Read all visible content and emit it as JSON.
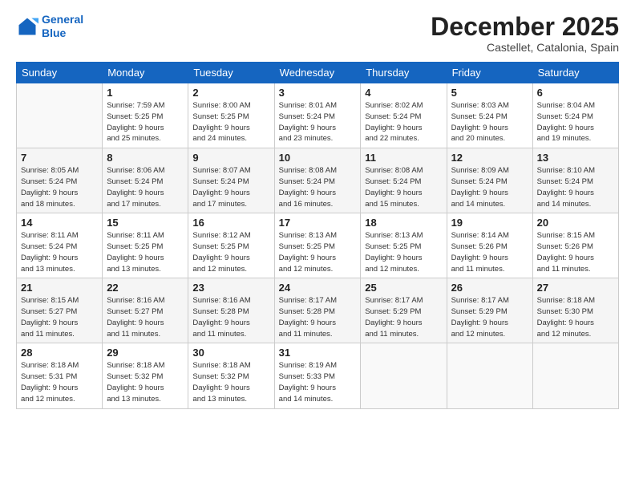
{
  "header": {
    "logo_line1": "General",
    "logo_line2": "Blue",
    "month_year": "December 2025",
    "location": "Castellet, Catalonia, Spain"
  },
  "weekdays": [
    "Sunday",
    "Monday",
    "Tuesday",
    "Wednesday",
    "Thursday",
    "Friday",
    "Saturday"
  ],
  "weeks": [
    [
      {
        "day": "",
        "info": ""
      },
      {
        "day": "1",
        "info": "Sunrise: 7:59 AM\nSunset: 5:25 PM\nDaylight: 9 hours\nand 25 minutes."
      },
      {
        "day": "2",
        "info": "Sunrise: 8:00 AM\nSunset: 5:25 PM\nDaylight: 9 hours\nand 24 minutes."
      },
      {
        "day": "3",
        "info": "Sunrise: 8:01 AM\nSunset: 5:24 PM\nDaylight: 9 hours\nand 23 minutes."
      },
      {
        "day": "4",
        "info": "Sunrise: 8:02 AM\nSunset: 5:24 PM\nDaylight: 9 hours\nand 22 minutes."
      },
      {
        "day": "5",
        "info": "Sunrise: 8:03 AM\nSunset: 5:24 PM\nDaylight: 9 hours\nand 20 minutes."
      },
      {
        "day": "6",
        "info": "Sunrise: 8:04 AM\nSunset: 5:24 PM\nDaylight: 9 hours\nand 19 minutes."
      }
    ],
    [
      {
        "day": "7",
        "info": "Sunrise: 8:05 AM\nSunset: 5:24 PM\nDaylight: 9 hours\nand 18 minutes."
      },
      {
        "day": "8",
        "info": "Sunrise: 8:06 AM\nSunset: 5:24 PM\nDaylight: 9 hours\nand 17 minutes."
      },
      {
        "day": "9",
        "info": "Sunrise: 8:07 AM\nSunset: 5:24 PM\nDaylight: 9 hours\nand 17 minutes."
      },
      {
        "day": "10",
        "info": "Sunrise: 8:08 AM\nSunset: 5:24 PM\nDaylight: 9 hours\nand 16 minutes."
      },
      {
        "day": "11",
        "info": "Sunrise: 8:08 AM\nSunset: 5:24 PM\nDaylight: 9 hours\nand 15 minutes."
      },
      {
        "day": "12",
        "info": "Sunrise: 8:09 AM\nSunset: 5:24 PM\nDaylight: 9 hours\nand 14 minutes."
      },
      {
        "day": "13",
        "info": "Sunrise: 8:10 AM\nSunset: 5:24 PM\nDaylight: 9 hours\nand 14 minutes."
      }
    ],
    [
      {
        "day": "14",
        "info": "Sunrise: 8:11 AM\nSunset: 5:24 PM\nDaylight: 9 hours\nand 13 minutes."
      },
      {
        "day": "15",
        "info": "Sunrise: 8:11 AM\nSunset: 5:25 PM\nDaylight: 9 hours\nand 13 minutes."
      },
      {
        "day": "16",
        "info": "Sunrise: 8:12 AM\nSunset: 5:25 PM\nDaylight: 9 hours\nand 12 minutes."
      },
      {
        "day": "17",
        "info": "Sunrise: 8:13 AM\nSunset: 5:25 PM\nDaylight: 9 hours\nand 12 minutes."
      },
      {
        "day": "18",
        "info": "Sunrise: 8:13 AM\nSunset: 5:25 PM\nDaylight: 9 hours\nand 12 minutes."
      },
      {
        "day": "19",
        "info": "Sunrise: 8:14 AM\nSunset: 5:26 PM\nDaylight: 9 hours\nand 11 minutes."
      },
      {
        "day": "20",
        "info": "Sunrise: 8:15 AM\nSunset: 5:26 PM\nDaylight: 9 hours\nand 11 minutes."
      }
    ],
    [
      {
        "day": "21",
        "info": "Sunrise: 8:15 AM\nSunset: 5:27 PM\nDaylight: 9 hours\nand 11 minutes."
      },
      {
        "day": "22",
        "info": "Sunrise: 8:16 AM\nSunset: 5:27 PM\nDaylight: 9 hours\nand 11 minutes."
      },
      {
        "day": "23",
        "info": "Sunrise: 8:16 AM\nSunset: 5:28 PM\nDaylight: 9 hours\nand 11 minutes."
      },
      {
        "day": "24",
        "info": "Sunrise: 8:17 AM\nSunset: 5:28 PM\nDaylight: 9 hours\nand 11 minutes."
      },
      {
        "day": "25",
        "info": "Sunrise: 8:17 AM\nSunset: 5:29 PM\nDaylight: 9 hours\nand 11 minutes."
      },
      {
        "day": "26",
        "info": "Sunrise: 8:17 AM\nSunset: 5:29 PM\nDaylight: 9 hours\nand 12 minutes."
      },
      {
        "day": "27",
        "info": "Sunrise: 8:18 AM\nSunset: 5:30 PM\nDaylight: 9 hours\nand 12 minutes."
      }
    ],
    [
      {
        "day": "28",
        "info": "Sunrise: 8:18 AM\nSunset: 5:31 PM\nDaylight: 9 hours\nand 12 minutes."
      },
      {
        "day": "29",
        "info": "Sunrise: 8:18 AM\nSunset: 5:32 PM\nDaylight: 9 hours\nand 13 minutes."
      },
      {
        "day": "30",
        "info": "Sunrise: 8:18 AM\nSunset: 5:32 PM\nDaylight: 9 hours\nand 13 minutes."
      },
      {
        "day": "31",
        "info": "Sunrise: 8:19 AM\nSunset: 5:33 PM\nDaylight: 9 hours\nand 14 minutes."
      },
      {
        "day": "",
        "info": ""
      },
      {
        "day": "",
        "info": ""
      },
      {
        "day": "",
        "info": ""
      }
    ]
  ]
}
